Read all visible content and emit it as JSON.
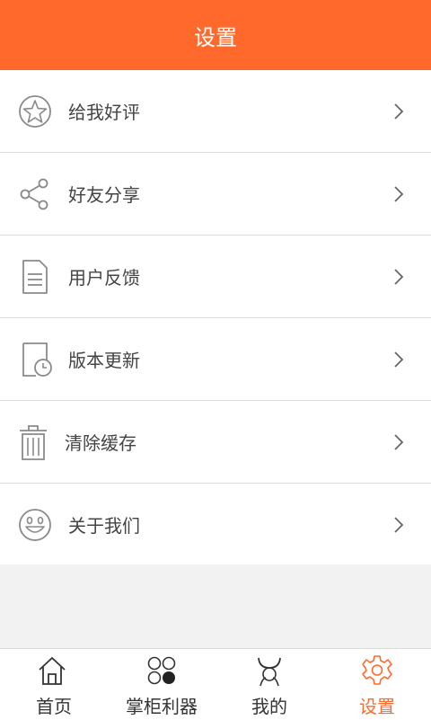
{
  "header": {
    "title": "设置"
  },
  "colors": {
    "accent": "#ff6a2c",
    "text": "#444444",
    "icon": "#8a8a8a"
  },
  "menu": [
    {
      "label": "给我好评",
      "icon": "star-icon"
    },
    {
      "label": "好友分享",
      "icon": "share-icon"
    },
    {
      "label": "用户反馈",
      "icon": "document-icon"
    },
    {
      "label": "版本更新",
      "icon": "update-clock-icon"
    },
    {
      "label": "清除缓存",
      "icon": "trash-icon"
    },
    {
      "label": "关于我们",
      "icon": "smiley-icon"
    }
  ],
  "tabs": [
    {
      "label": "首页",
      "icon": "home-icon",
      "active": false
    },
    {
      "label": "掌柜利器",
      "icon": "circles-icon",
      "active": false
    },
    {
      "label": "我的",
      "icon": "person-icon",
      "active": false
    },
    {
      "label": "设置",
      "icon": "gear-icon",
      "active": true
    }
  ]
}
